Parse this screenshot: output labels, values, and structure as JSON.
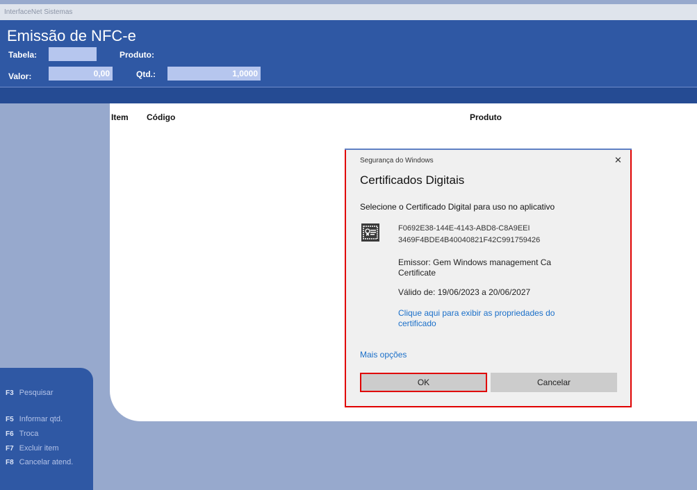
{
  "window": {
    "app_name": "InterfaceNet Sistemas"
  },
  "header": {
    "title": "Emissão de NFC-e",
    "tabela_label": "Tabela:",
    "tabela_value": "",
    "produto_label": "Produto:",
    "valor_label": "Valor:",
    "valor_value": "0,00",
    "qtd_label": "Qtd.:",
    "qtd_value": "1,0000"
  },
  "table": {
    "columns": [
      "Item",
      "Código",
      "Produto"
    ]
  },
  "shortcuts": [
    {
      "key": "F3",
      "label": "Pesquisar"
    },
    {
      "key": "F5",
      "label": "Informar qtd."
    },
    {
      "key": "F6",
      "label": "Troca"
    },
    {
      "key": "F7",
      "label": "Excluir item"
    },
    {
      "key": "F8",
      "label": "Cancelar atend."
    }
  ],
  "dialog": {
    "caption": "Segurança do Windows",
    "close_glyph": "✕",
    "title": "Certificados Digitais",
    "instruction": "Selecione o Certificado Digital para uso no aplicativo",
    "cert_line1": "F0692E38-144E-4143-ABD8-C8A9EEI",
    "cert_line2": "3469F4BDE4B40040821F42C991759426",
    "issuer": "Emissor: Gem Windows management Ca Certificate",
    "validity": "Válido de: 19/06/2023 a 20/06/2027",
    "properties_link": "Clique aqui para exibir as propriedades do certificado",
    "more_options": "Mais opções",
    "ok_label": "OK",
    "cancel_label": "Cancelar"
  },
  "colors": {
    "header_blue": "#2f58a4",
    "panel_blue": "#97a9cd",
    "highlight_red": "#e00000",
    "link_blue": "#1a6fc9"
  },
  "icons": [
    "certificate-icon",
    "close-icon"
  ]
}
